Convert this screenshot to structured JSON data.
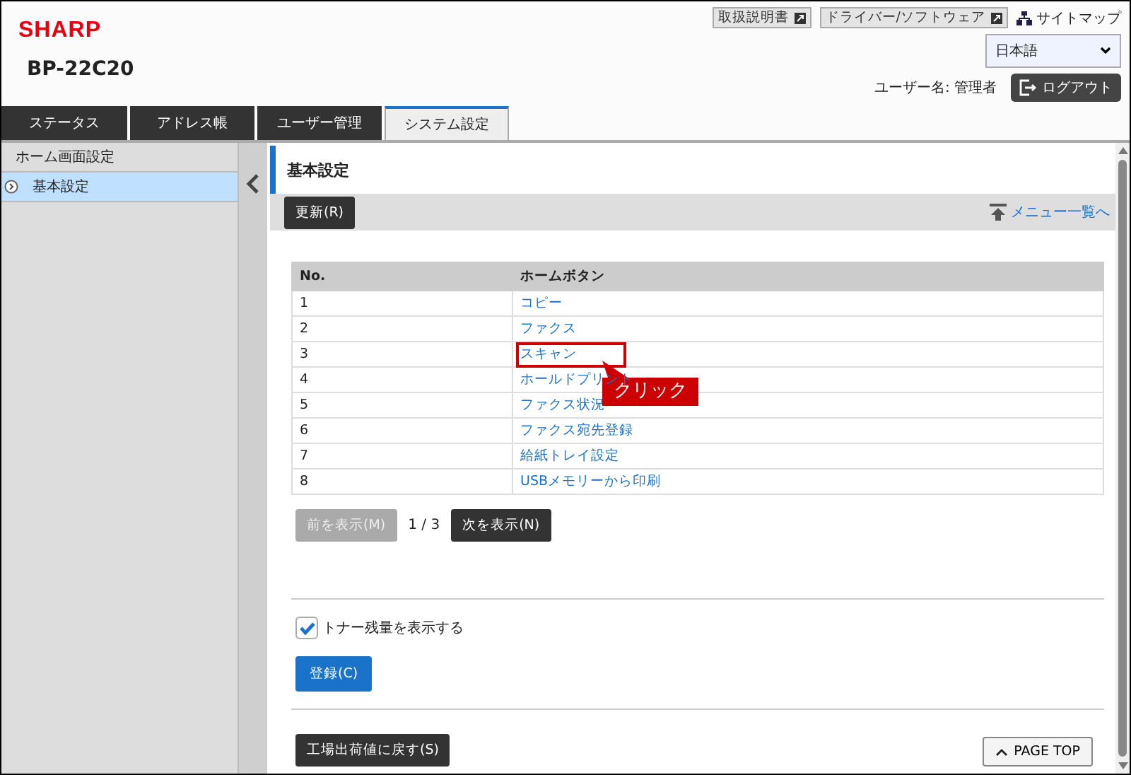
{
  "header": {
    "brand": "SHARP",
    "model": "BP-22C20",
    "links": [
      {
        "label": "取扱説明書",
        "kind": "external"
      },
      {
        "label": "ドライバー/ソフトウェア",
        "kind": "external"
      },
      {
        "label": "サイトマップ",
        "kind": "sitemap"
      }
    ],
    "language": "日本語",
    "user_label": "ユーザー名: 管理者",
    "logout": "ログアウト"
  },
  "tabs": [
    {
      "label": "ステータス",
      "selected": false
    },
    {
      "label": "アドレス帳",
      "selected": false
    },
    {
      "label": "ユーザー管理",
      "selected": false
    },
    {
      "label": "システム設定",
      "selected": true
    }
  ],
  "sidebar": {
    "items": [
      {
        "label": "ホーム画面設定",
        "selected": false,
        "kind": "heading"
      },
      {
        "label": "基本設定",
        "selected": true,
        "kind": "item"
      }
    ]
  },
  "page": {
    "title": "基本設定",
    "update_button": "更新(R)",
    "menu_link": "メニュー一覧へ",
    "table": {
      "columns": [
        "No.",
        "ホームボタン"
      ],
      "rows": [
        {
          "no": "1",
          "name": "コピー",
          "highlighted": false
        },
        {
          "no": "2",
          "name": "ファクス",
          "highlighted": false
        },
        {
          "no": "3",
          "name": "スキャン",
          "highlighted": true
        },
        {
          "no": "4",
          "name": "ホールドプリント",
          "highlighted": false
        },
        {
          "no": "5",
          "name": "ファクス状況",
          "highlighted": false
        },
        {
          "no": "6",
          "name": "ファクス宛先登録",
          "highlighted": false
        },
        {
          "no": "7",
          "name": "給紙トレイ設定",
          "highlighted": false
        },
        {
          "no": "8",
          "name": "USBメモリーから印刷",
          "highlighted": false
        }
      ]
    },
    "pager": {
      "prev": {
        "label": "前を表示(M)",
        "disabled": true
      },
      "position": "1 / 3",
      "next": {
        "label": "次を表示(N)",
        "disabled": false
      }
    },
    "toner_checkbox": {
      "label": "トナー残量を表示する",
      "checked": true
    },
    "register_button": "登録(C)",
    "reset_button": "工場出荷値に戻す(S)",
    "page_top": "PAGE TOP"
  },
  "callout": {
    "text": "クリック"
  }
}
